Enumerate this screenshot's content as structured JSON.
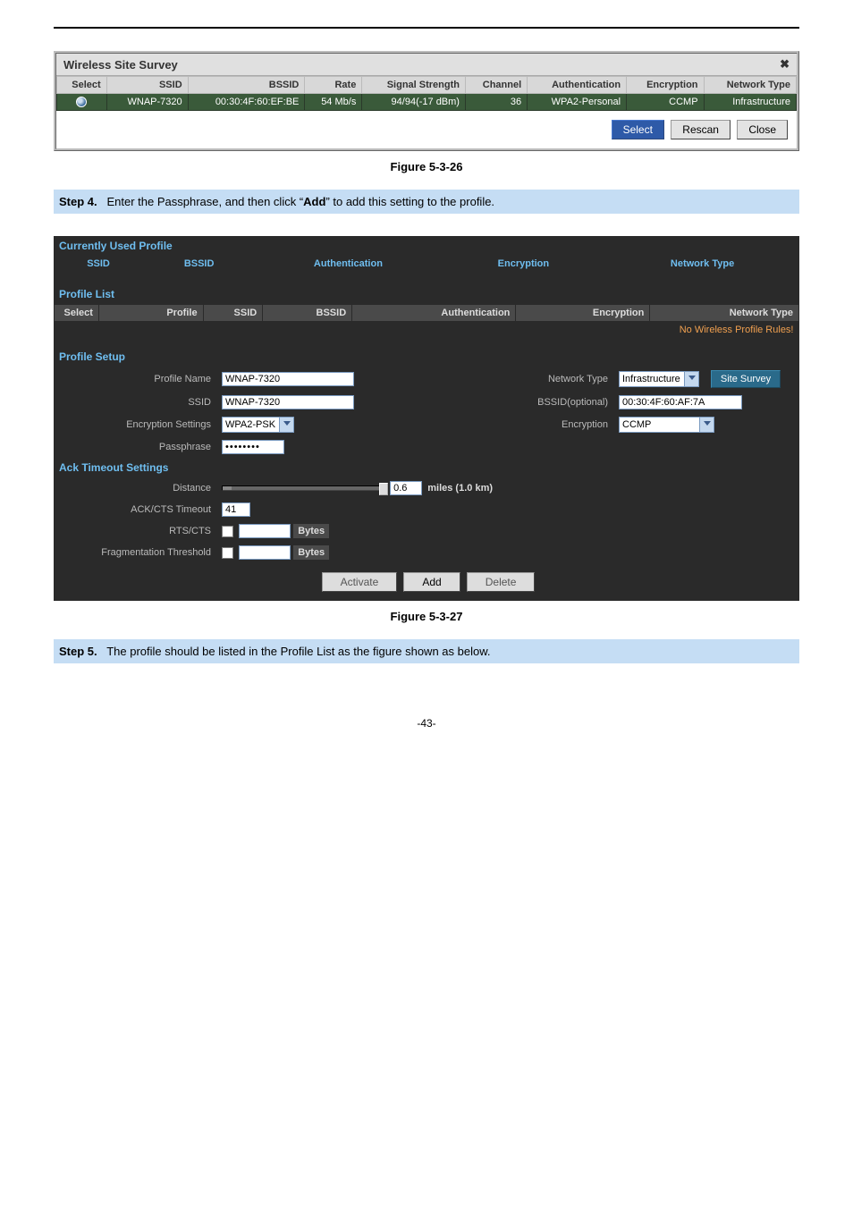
{
  "survey": {
    "title": "Wireless Site Survey",
    "close": "✖",
    "headers": [
      "Select",
      "SSID",
      "BSSID",
      "Rate",
      "Signal Strength",
      "Channel",
      "Authentication",
      "Encryption",
      "Network Type"
    ],
    "row": {
      "ssid": "WNAP-7320",
      "bssid": "00:30:4F:60:EF:BE",
      "rate": "54 Mb/s",
      "signal": "94/94(-17 dBm)",
      "channel": "36",
      "auth": "WPA2-Personal",
      "enc": "CCMP",
      "net": "Infrastructure"
    },
    "btn_select": "Select",
    "btn_rescan": "Rescan",
    "btn_close": "Close"
  },
  "fig1": "Figure 5-3-26",
  "step4": {
    "num": "Step 4.",
    "text_a": "Enter the Passphrase, and then click “",
    "bold": "Add",
    "text_b": "” to add this setting to the profile."
  },
  "cu": {
    "used_title": "Currently Used Profile",
    "used_headers": [
      "SSID",
      "BSSID",
      "Authentication",
      "Encryption",
      "Network Type"
    ],
    "plist_title": "Profile List",
    "plist_headers": [
      "Select",
      "Profile",
      "SSID",
      "BSSID",
      "Authentication",
      "Encryption",
      "Network Type"
    ],
    "plist_empty": "No Wireless Profile Rules!",
    "psetup_title": "Profile Setup",
    "profile_name_label": "Profile Name",
    "profile_name": "WNAP-7320",
    "network_type_label": "Network Type",
    "network_type": "Infrastructure",
    "site_survey": "Site Survey",
    "ssid_label": "SSID",
    "ssid": "WNAP-7320",
    "bssid_opt_label": "BSSID(optional)",
    "bssid_opt": "00:30:4F:60:AF:7A",
    "enc_set_label": "Encryption Settings",
    "enc_set": "WPA2-PSK",
    "enc_label": "Encryption",
    "enc": "CCMP",
    "pass_label": "Passphrase",
    "pass": "••••••••",
    "ack_title": "Ack Timeout Settings",
    "dist_label": "Distance",
    "dist_val": "0.6",
    "dist_unit": "miles (1.0 km)",
    "ackcts_label": "ACK/CTS Timeout",
    "ackcts": "41",
    "rtscts_label": "RTS/CTS",
    "bytes": "Bytes",
    "frag_label": "Fragmentation Threshold",
    "btn_activate": "Activate",
    "btn_add": "Add",
    "btn_delete": "Delete"
  },
  "fig2": "Figure 5-3-27",
  "step5": {
    "num": "Step 5.",
    "text": "The profile should be listed in the Profile List as the figure shown as below."
  },
  "page": "-43-"
}
